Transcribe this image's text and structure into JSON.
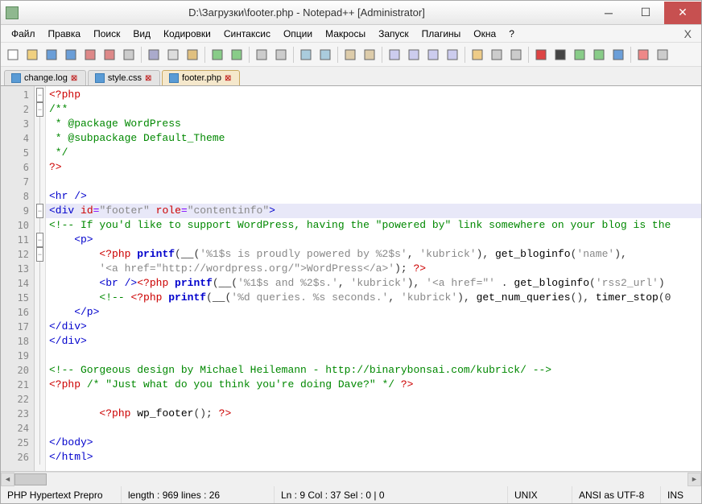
{
  "title": "D:\\Загрузки\\footer.php - Notepad++ [Administrator]",
  "menus": [
    "Файл",
    "Правка",
    "Поиск",
    "Вид",
    "Кодировки",
    "Синтаксис",
    "Опции",
    "Макросы",
    "Запуск",
    "Плагины",
    "Окна",
    "?"
  ],
  "tabs": [
    {
      "label": "change.log",
      "active": false
    },
    {
      "label": "style.css",
      "active": false
    },
    {
      "label": "footer.php",
      "active": true
    }
  ],
  "code_lines": [
    [
      [
        "php",
        "<?php"
      ]
    ],
    [
      [
        "com",
        "/**"
      ]
    ],
    [
      [
        "com",
        " * @package WordPress"
      ]
    ],
    [
      [
        "com",
        " * @subpackage Default_Theme"
      ]
    ],
    [
      [
        "com",
        " */"
      ]
    ],
    [
      [
        "php",
        "?>"
      ]
    ],
    [],
    [
      [
        "tag",
        "<hr />"
      ]
    ],
    [
      [
        "tag",
        "<div "
      ],
      [
        "attr",
        "id"
      ],
      [
        "op",
        "="
      ],
      [
        "str",
        "\"footer\""
      ],
      [
        "tag",
        " "
      ],
      [
        "attr",
        "role"
      ],
      [
        "op",
        "="
      ],
      [
        "str",
        "\"contentinfo\""
      ],
      [
        "tag",
        ">"
      ]
    ],
    [
      [
        "com",
        "<!-- If you'd like to support WordPress, having the \"powered by\" link somewhere on your blog is the"
      ]
    ],
    [
      [
        "tag",
        "    <p>"
      ]
    ],
    [
      [
        "txt",
        "        "
      ],
      [
        "php",
        "<?php "
      ],
      [
        "kw",
        "printf"
      ],
      [
        "txt",
        "("
      ],
      [
        "func",
        "__"
      ],
      [
        "txt",
        "("
      ],
      [
        "str",
        "'%1$s is proudly powered by %2$s'"
      ],
      [
        "txt",
        ", "
      ],
      [
        "str",
        "'kubrick'"
      ],
      [
        "txt",
        "), "
      ],
      [
        "func",
        "get_bloginfo"
      ],
      [
        "txt",
        "("
      ],
      [
        "str",
        "'name'"
      ],
      [
        "txt",
        "),"
      ]
    ],
    [
      [
        "txt",
        "        "
      ],
      [
        "str",
        "'<a href=\"http://wordpress.org/\">WordPress</a>'"
      ],
      [
        "txt",
        "); "
      ],
      [
        "php",
        "?>"
      ]
    ],
    [
      [
        "txt",
        "        "
      ],
      [
        "tag",
        "<br />"
      ],
      [
        "php",
        "<?php "
      ],
      [
        "kw",
        "printf"
      ],
      [
        "txt",
        "("
      ],
      [
        "func",
        "__"
      ],
      [
        "txt",
        "("
      ],
      [
        "str",
        "'%1$s and %2$s.'"
      ],
      [
        "txt",
        ", "
      ],
      [
        "str",
        "'kubrick'"
      ],
      [
        "txt",
        "), "
      ],
      [
        "str",
        "'<a href=\"'"
      ],
      [
        "txt",
        " . "
      ],
      [
        "func",
        "get_bloginfo"
      ],
      [
        "txt",
        "("
      ],
      [
        "str",
        "'rss2_url'"
      ],
      [
        "txt",
        ")"
      ]
    ],
    [
      [
        "txt",
        "        "
      ],
      [
        "com",
        "<!-- "
      ],
      [
        "php",
        "<?php "
      ],
      [
        "kw",
        "printf"
      ],
      [
        "txt",
        "("
      ],
      [
        "func",
        "__"
      ],
      [
        "txt",
        "("
      ],
      [
        "str",
        "'%d queries. %s seconds.'"
      ],
      [
        "txt",
        ", "
      ],
      [
        "str",
        "'kubrick'"
      ],
      [
        "txt",
        "), "
      ],
      [
        "func",
        "get_num_queries"
      ],
      [
        "txt",
        "(), "
      ],
      [
        "func",
        "timer_stop"
      ],
      [
        "txt",
        "(0"
      ]
    ],
    [
      [
        "tag",
        "    </p>"
      ]
    ],
    [
      [
        "tag",
        "</div>"
      ]
    ],
    [
      [
        "tag",
        "</div>"
      ]
    ],
    [],
    [
      [
        "com",
        "<!-- Gorgeous design by Michael Heilemann - http://binarybonsai.com/kubrick/ -->"
      ]
    ],
    [
      [
        "php",
        "<?php "
      ],
      [
        "com",
        "/* \"Just what do you think you're doing Dave?\" */"
      ],
      [
        "php",
        " ?>"
      ]
    ],
    [],
    [
      [
        "txt",
        "        "
      ],
      [
        "php",
        "<?php "
      ],
      [
        "func",
        "wp_footer"
      ],
      [
        "txt",
        "(); "
      ],
      [
        "php",
        "?>"
      ]
    ],
    [],
    [
      [
        "tag",
        "</body>"
      ]
    ],
    [
      [
        "tag",
        "</html>"
      ]
    ]
  ],
  "highlighted_line": 9,
  "fold_marks": {
    "1": "minus",
    "2": "minus",
    "9": "minus",
    "11": "minus",
    "12": "minus"
  },
  "status": {
    "lang": "PHP Hypertext Prepro",
    "length": "length : 969    lines : 26",
    "pos": "Ln : 9   Col : 37   Sel : 0 | 0",
    "eol": "UNIX",
    "enc": "ANSI as UTF-8",
    "mode": "INS"
  },
  "toolbar_icons": [
    "new-file-icon",
    "open-file-icon",
    "save-icon",
    "save-all-icon",
    "close-icon",
    "close-all-icon",
    "print-icon",
    "sep",
    "cut-icon",
    "copy-icon",
    "paste-icon",
    "sep",
    "undo-icon",
    "redo-icon",
    "sep",
    "find-icon",
    "replace-icon",
    "sep",
    "zoom-in-icon",
    "zoom-out-icon",
    "sep",
    "sync-v-icon",
    "sync-h-icon",
    "sep",
    "wrap-icon",
    "whitespace-icon",
    "indent-guide-icon",
    "lang-icon",
    "sep",
    "folder-icon",
    "doc-map-icon",
    "func-list-icon",
    "sep",
    "record-macro-icon",
    "stop-macro-icon",
    "play-macro-icon",
    "play-multi-icon",
    "save-macro-icon",
    "sep",
    "spellcheck-icon",
    "doc-switch-icon"
  ]
}
